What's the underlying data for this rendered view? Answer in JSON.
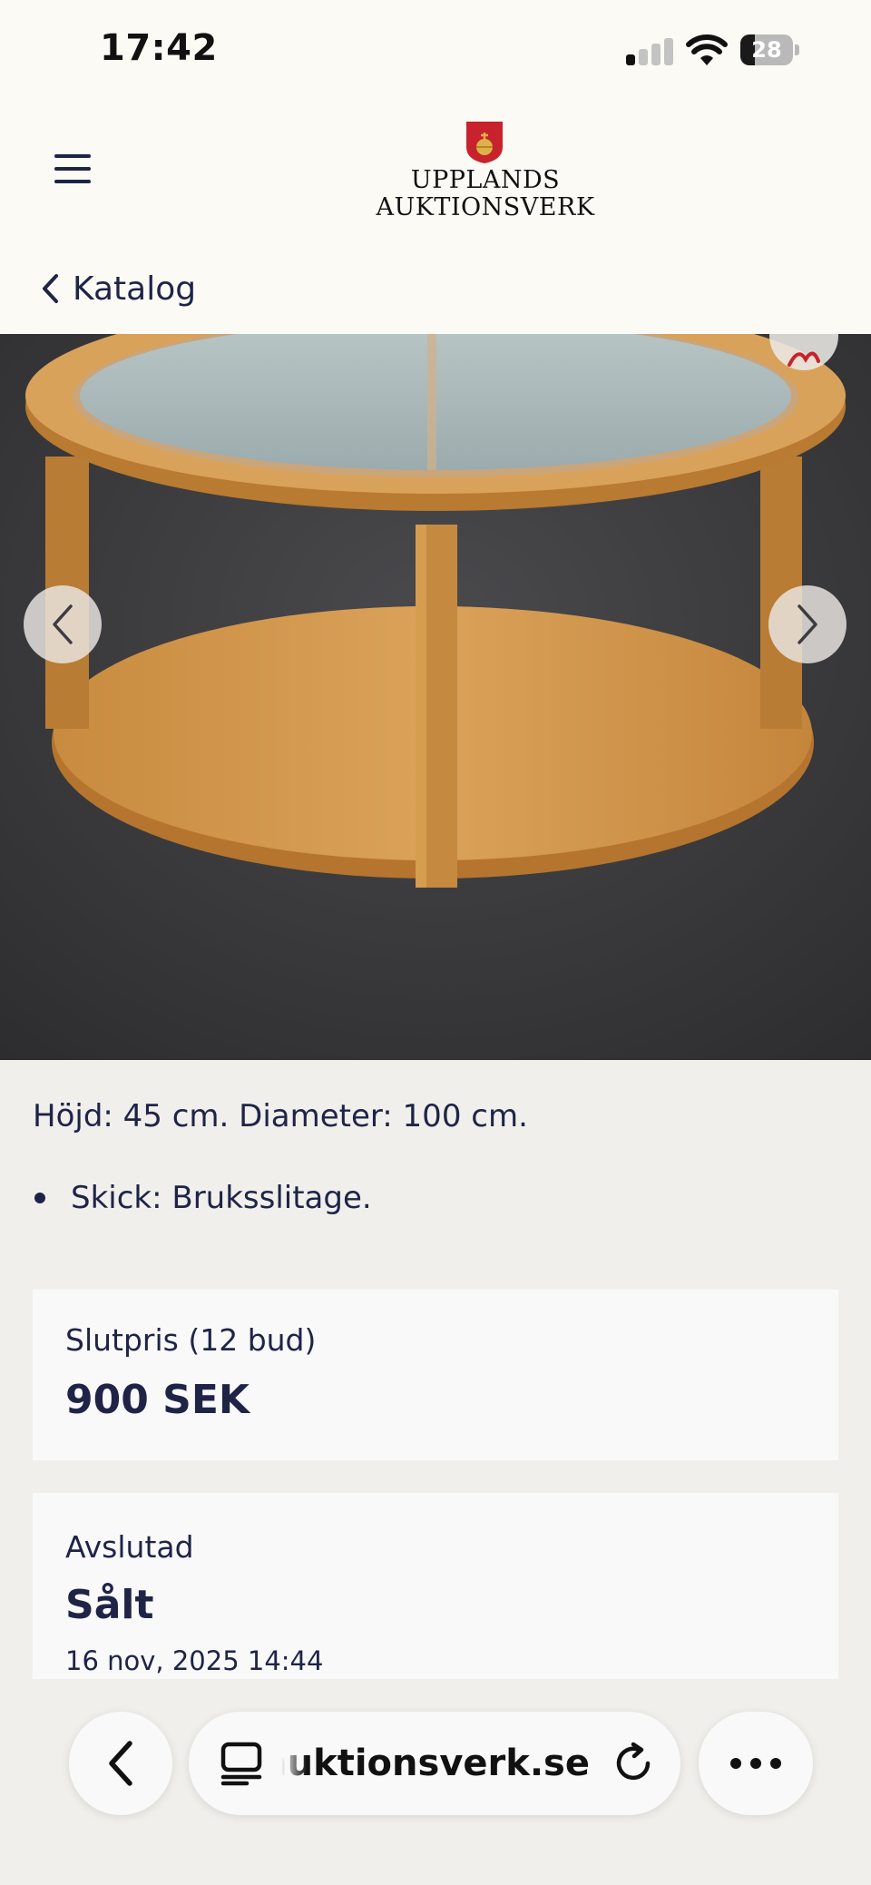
{
  "status_bar": {
    "time": "17:42",
    "battery_level": "28",
    "battery_fraction": 0.28,
    "signal_bars_active": 1,
    "signal_bars_total": 4,
    "icons": [
      "cellular-signal-icon",
      "wifi-icon",
      "battery-icon"
    ]
  },
  "header": {
    "logo_line1": "UPPLANDS",
    "logo_line2": "AUKTIONSVERK",
    "menu_icon": "hamburger-menu-icon"
  },
  "navigation": {
    "back_label": "Katalog",
    "back_icon": "chevron-left-icon"
  },
  "gallery": {
    "prev_icon": "chevron-left-icon",
    "next_icon": "chevron-right-icon",
    "favorite_icon": "heart-icon"
  },
  "description": {
    "dimensions": "Höjd: 45 cm. Diameter: 100 cm.",
    "bullets": [
      "Skick: Bruksslitage."
    ]
  },
  "price_card": {
    "label": "Slutpris (12 bud)",
    "value": "900 SEK"
  },
  "status_card": {
    "label": "Avslutad",
    "value": "Sålt",
    "date": "16 nov, 2025 14:44"
  },
  "browser": {
    "address": "auktionsverk.se",
    "icons": [
      "back-arrow-icon",
      "tabs-icon",
      "reload-icon",
      "more-icon"
    ]
  },
  "colors": {
    "navy_text": "#1f2447",
    "page_background": "#f1efec",
    "header_background": "#fcfaf5",
    "card_background": "#f9f9fa",
    "logo_red": "#c8222c"
  }
}
